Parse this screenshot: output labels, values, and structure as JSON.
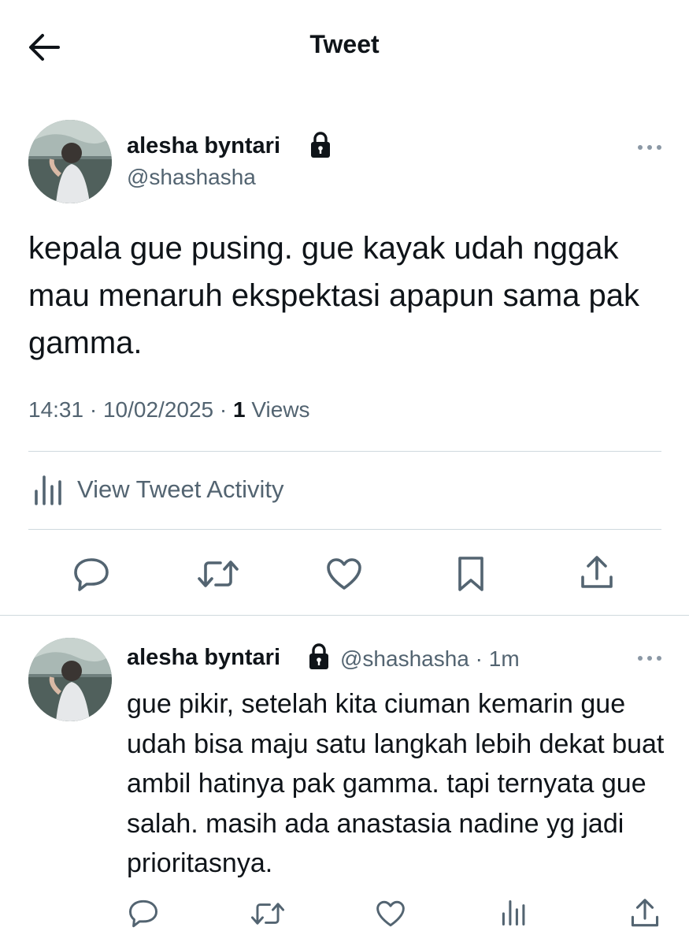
{
  "header": {
    "title": "Tweet"
  },
  "main_tweet": {
    "author_name": "alesha byntari",
    "handle": "@shashasha",
    "text": "kepala gue pusing. gue kayak udah nggak mau menaruh ekspektasi apapun sama pak gamma.",
    "time": "14:31",
    "date": "10/02/2025",
    "views_count": "1",
    "views_label": "Views",
    "activity_label": "View Tweet Activity"
  },
  "reply_tweet": {
    "author_name": "alesha byntari",
    "handle": "@shashasha",
    "time_ago": "1m",
    "text": "gue pikir, setelah kita ciuman kemarin gue udah bisa maju satu langkah lebih dekat buat ambil hatinya pak gamma. tapi ternyata gue salah. masih ada anastasia nadine yg jadi prioritasnya."
  },
  "icons": {
    "back": "arrow-left-icon",
    "lock": "lock-icon",
    "more": "more-horizontal-icon",
    "reply": "reply-icon",
    "retweet": "retweet-icon",
    "like": "heart-icon",
    "bookmark": "bookmark-icon",
    "share": "share-icon",
    "analytics": "analytics-icon"
  },
  "colors": {
    "text": "#0f1419",
    "secondary": "#536471",
    "divider": "#cfd9de"
  }
}
